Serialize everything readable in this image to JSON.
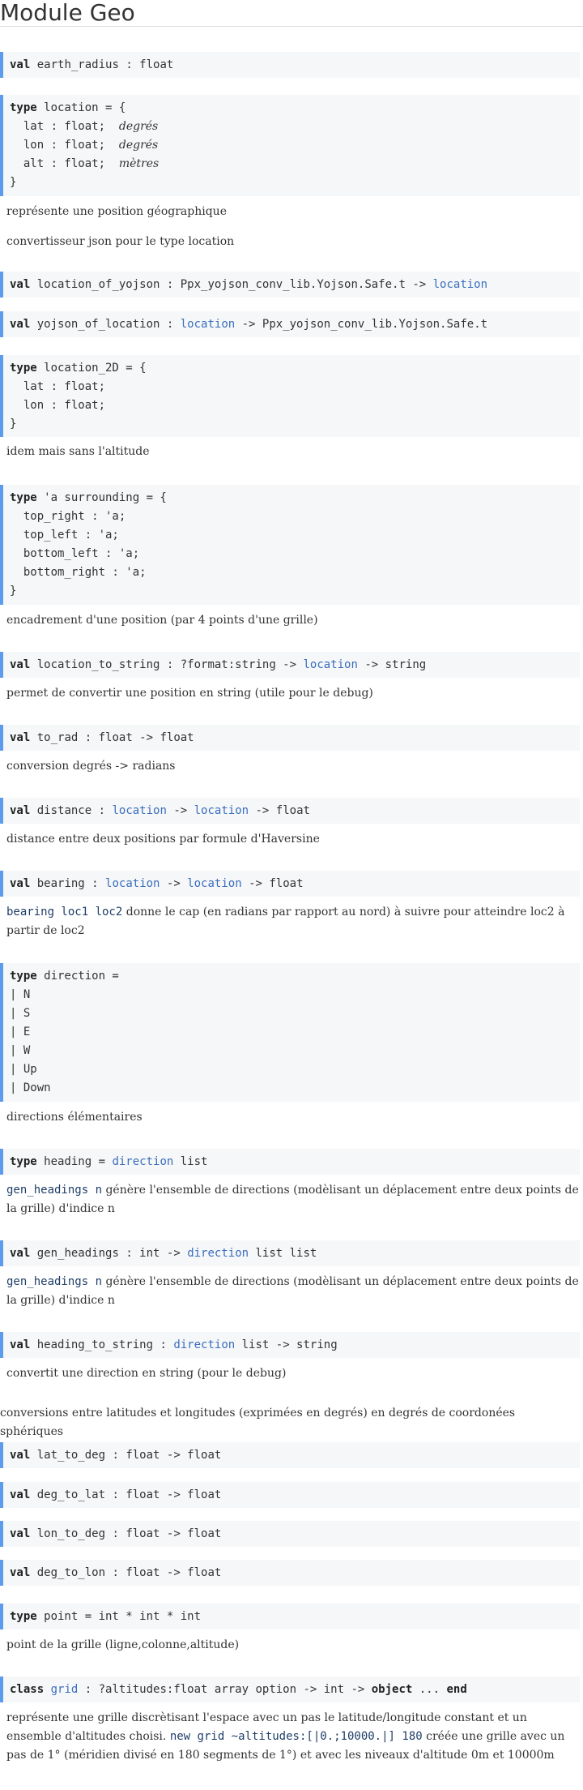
{
  "page_title": "Module Geo",
  "kw": {
    "val": "val",
    "type": "type",
    "class": "class"
  },
  "earth_radius": {
    "name": "earth_radius",
    "sig": " : float"
  },
  "location": {
    "head": " location = {",
    "fields": [
      {
        "text": "  lat : float;  ",
        "comment": "degrés"
      },
      {
        "text": "  lon : float;  ",
        "comment": "degrés"
      },
      {
        "text": "  alt : float;  ",
        "comment": "mètres"
      }
    ],
    "close": "}",
    "doc": "représente une position géographique"
  },
  "json_doc": "convertisseur json pour le type location",
  "location_of_yojson": {
    "name": "location_of_yojson",
    "sig": " : Ppx_yojson_conv_lib.Yojson.Safe.t -> ",
    "ret": "location"
  },
  "yojson_of_location": {
    "name": "yojson_of_location",
    "pre": " : ",
    "arg": "location",
    "sig": " -> Ppx_yojson_conv_lib.Yojson.Safe.t"
  },
  "location_2d": {
    "head": " location_2D = {",
    "fields": [
      "  lat : float;",
      "  lon : float;"
    ],
    "close": "}",
    "doc": "idem mais sans l'altitude"
  },
  "surrounding": {
    "head": " 'a surrounding = {",
    "fields": [
      "  top_right : 'a;",
      "  top_left : 'a;",
      "  bottom_left : 'a;",
      "  bottom_right : 'a;"
    ],
    "close": "}",
    "doc": "encadrement d'une position (par 4 points d'une grille)"
  },
  "location_to_string": {
    "name": "location_to_string",
    "pre": " : ?format:string -> ",
    "arg": "location",
    "sig": " -> string",
    "doc": "permet de convertir une position en string (utile pour le debug)"
  },
  "to_rad": {
    "name": "to_rad",
    "sig": " : float -> float",
    "doc": "conversion degrés -> radians"
  },
  "distance": {
    "name": "distance",
    "pre": " : ",
    "a1": "location",
    "mid": " -> ",
    "a2": "location",
    "sig": " -> float",
    "doc": "distance entre deux positions par formule d'Haversine"
  },
  "bearing": {
    "name": "bearing",
    "pre": " : ",
    "a1": "location",
    "mid": " -> ",
    "a2": "location",
    "sig": " -> float",
    "doc_code": "bearing loc1 loc2",
    "doc_text": " donne le cap (en radians par rapport au nord) à suivre pour atteindre loc2 à partir de loc2"
  },
  "direction": {
    "head": " direction =",
    "cases": [
      "| N",
      "| S",
      "| E",
      "| W",
      "| Up",
      "| Down"
    ],
    "doc": "directions élémentaires"
  },
  "heading": {
    "pre": " heading = ",
    "arg": "direction",
    "sig": " list",
    "doc_code": "gen_headings n",
    "doc_text": " génère l'ensemble de directions (modèlisant un déplacement entre deux points de la grille) d'indice n"
  },
  "gen_headings": {
    "name": "gen_headings",
    "pre": " : int -> ",
    "arg": "direction",
    "sig": " list list",
    "doc_code": "gen_headings n",
    "doc_text": " génère l'ensemble de directions (modèlisant un déplacement entre deux points de la grille) d'indice n"
  },
  "heading_to_string": {
    "name": "heading_to_string",
    "pre": " : ",
    "arg": "direction",
    "sig": " list -> string",
    "doc": "convertit une direction en string (pour le debug)"
  },
  "conversions_doc": "conversions entre latitudes et longitudes (exprimées en degrés) en degrés de coordonées sphériques",
  "lat_to_deg": {
    "name": "lat_to_deg",
    "sig": " : float -> float"
  },
  "deg_to_lat": {
    "name": "deg_to_lat",
    "sig": " : float -> float"
  },
  "lon_to_deg": {
    "name": "lon_to_deg",
    "sig": " : float -> float"
  },
  "deg_to_lon": {
    "name": "deg_to_lon",
    "sig": " : float -> float"
  },
  "point": {
    "sig": " point = int * int * int",
    "doc": "point de la grille (ligne,colonne,altitude)"
  },
  "grid": {
    "pre": " ",
    "name": "grid",
    "sig": " : ?altitudes:float array option -> int -> ",
    "obj": "object",
    "dots": " ... ",
    "end": "end",
    "doc_1": "représente une grille discrètisant l'espace avec un pas le latitude/longitude constant et un ensemble d'altitudes choisi. ",
    "doc_code": "new grid ~altitudes:[|0.;10000.|] 180",
    "doc_2": " créée une grille avec un pas de 1° (méridien divisé en 180 segments de 1°) et avec les niveaux d'altitude 0m et 10000m"
  }
}
